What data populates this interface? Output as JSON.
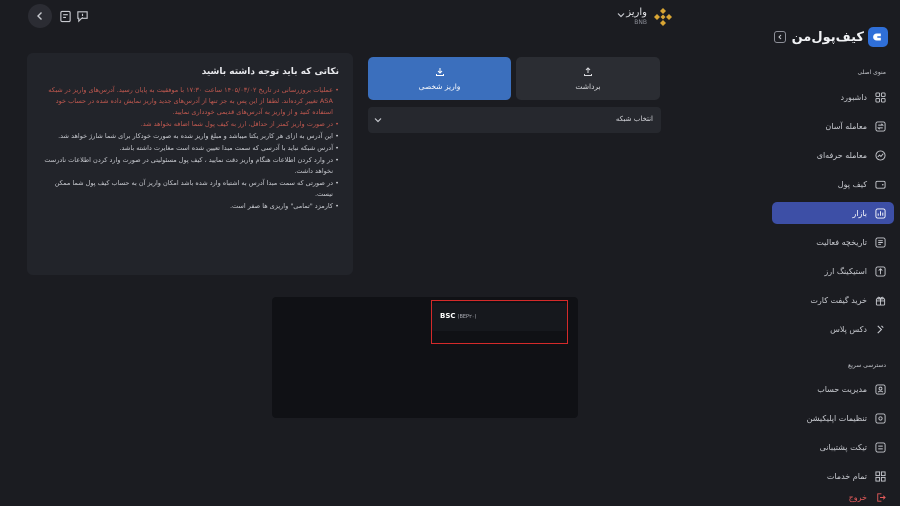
{
  "app": {
    "brand_name": "کیف‌پول‌من",
    "accent_color": "#3b6fbd"
  },
  "topbar": {
    "coin_name": "واریز",
    "coin_subtitle": "BNB",
    "icons": [
      "chevron-left-icon",
      "receipt-icon",
      "message-alert-icon"
    ]
  },
  "sidebar": {
    "section_general": "منوی اصلی",
    "items": [
      {
        "label": "داشبورد",
        "icon": "dashboard-icon"
      },
      {
        "label": "معامله آسان",
        "icon": "swap-icon"
      },
      {
        "label": "معامله حرفه‌ای",
        "icon": "chart-icon"
      },
      {
        "label": "کیف پول",
        "icon": "wallet-icon"
      },
      {
        "label": "بازار",
        "icon": "market-icon"
      },
      {
        "label": "تاریخچه فعالیت",
        "icon": "history-icon"
      },
      {
        "label": "استیکینگ ارز",
        "icon": "staking-icon"
      },
      {
        "label": "خرید گیفت کارت",
        "icon": "gift-icon"
      },
      {
        "label": "دکس پلاس",
        "icon": "dex-icon"
      }
    ],
    "section_quick": "دسترسی سریع",
    "quick_items": [
      {
        "label": "مدیریت حساب",
        "icon": "user-icon"
      },
      {
        "label": "تنظیمات اپلیکیشن",
        "icon": "settings-icon"
      },
      {
        "label": "تیکت پشتیبانی",
        "icon": "ticket-icon"
      },
      {
        "label": "تمام خدمات",
        "icon": "grid-icon"
      }
    ],
    "logout_label": "خروج"
  },
  "tabs": {
    "deposit_label": "واریز شخصی",
    "withdraw_label": "برداشت"
  },
  "network_select": {
    "label": "انتخاب شبکه"
  },
  "dropdown": {
    "option_name": "BSC",
    "option_sub": "(BEP۲۰)"
  },
  "notes": {
    "title": "نکاتی که باید توجه داشته باشید",
    "items": [
      {
        "text": "عملیات بروزرسانی در تاریخ ۱۴۰۵/۰۳/۰۲ ساعت ۱۷:۳۰ با موفقیت به پایان رسید. آدرس‌های واریز در شبکه ASA تغییر کرده‌اند. لطفا از این پس به جز تنها از آدرس‌های جدید واریز نمایش داده شده در حساب خود استفاده کنید و از واریز به آدرس‌های قدیمی خودداری نمایید.",
        "warn": true
      },
      {
        "text": "در صورت واریز کمتر از حداقل، ارز به کیف پول شما اضافه نخواهد شد.",
        "warn": true
      },
      {
        "text": "این آدرس به ازای هر کاربر یکتا میباشد و مبلغ واریز شده به صورت خودکار برای شما شارژ خواهد شد.",
        "warn": false
      },
      {
        "text": "آدرس شبکه نباید با آدرسی که سمت مبدا تعیین شده است مغایرت داشته باشد.",
        "warn": false
      },
      {
        "text": "در وارد کردن اطلاعات هنگام واریز دقت نمایید ، کیف پول مسئولیتی در صورت وارد کردن اطلاعات نادرست نخواهد داشت.",
        "warn": false
      },
      {
        "text": "در صورتی که سمت مبدا آدرس به اشتباه وارد شده باشد امکان واریز آن به حساب کیف پول شما ممکن نیست.",
        "warn": false
      },
      {
        "text": "کارمزد \"تمامی\" واریزی ها صفر است.",
        "warn": false
      }
    ]
  }
}
